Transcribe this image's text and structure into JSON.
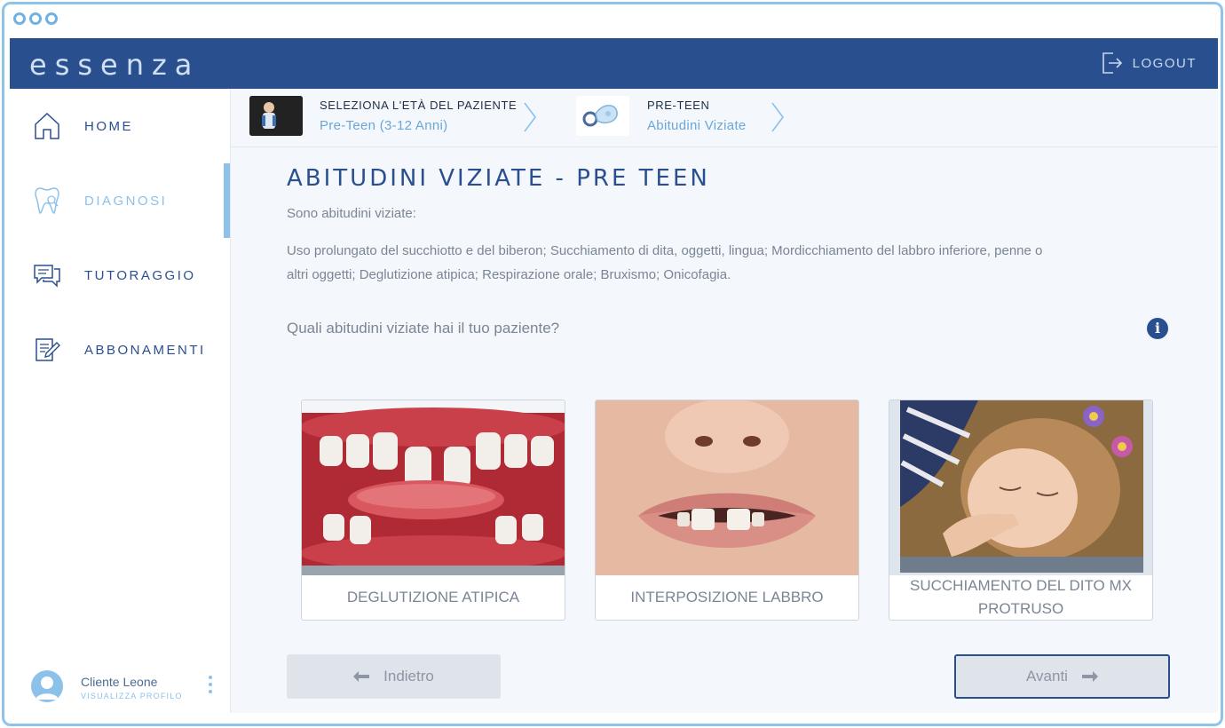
{
  "app": {
    "logo": "essenza",
    "logout_label": "LOGOUT"
  },
  "sidebar": {
    "items": [
      {
        "label": "HOME",
        "icon": "home-icon"
      },
      {
        "label": "DIAGNOSI",
        "icon": "tooth-icon"
      },
      {
        "label": "TUTORAGGIO",
        "icon": "chat-icon"
      },
      {
        "label": "ABBONAMENTI",
        "icon": "edit-icon"
      }
    ],
    "profile": {
      "name": "Cliente Leone",
      "link": "VISUALIZZA PROFILO"
    }
  },
  "breadcrumb": {
    "steps": [
      {
        "title": "SELEZIONA L'ETÀ DEL PAZIENTE",
        "value": "Pre-Teen (3-12 Anni)"
      },
      {
        "title": "PRE-TEEN",
        "value": "Abitudini Viziate"
      }
    ]
  },
  "main": {
    "title": "ABITUDINI VIZIATE - PRE TEEN",
    "intro": "Sono abitudini viziate:",
    "description": "Uso prolungato del succhiotto e del biberon; Succhiamento di dita, oggetti, lingua; Mordicchiamento del labbro inferiore, penne o altri oggetti; Deglutizione atipica; Respirazione orale; Bruxismo; Onicofagia.",
    "question": "Quali abitudini viziate hai il tuo paziente?",
    "info_glyph": "i",
    "cards": [
      {
        "label": "DEGLUTIZIONE ATIPICA"
      },
      {
        "label": "INTERPOSIZIONE LABBRO"
      },
      {
        "label": "SUCCHIAMENTO DEL DITO MX PROTRUSO"
      }
    ],
    "back_label": "Indietro",
    "next_label": "Avanti"
  },
  "colors": {
    "header": "#2a4f8f",
    "accent": "#8cc1ea",
    "text_muted": "#7b8594"
  }
}
